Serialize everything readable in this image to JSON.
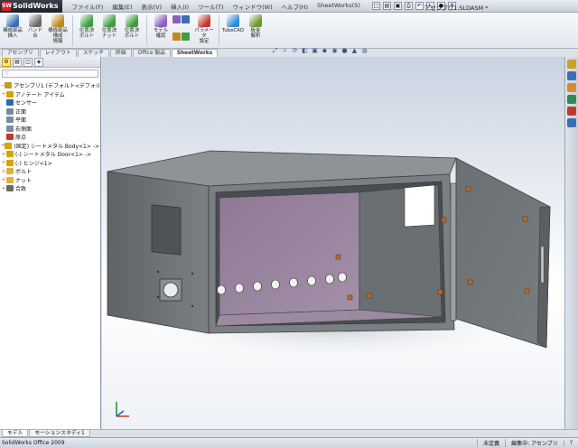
{
  "app": {
    "name": "SolidWorks",
    "document_title": "アセンブリ1.SLDASM *"
  },
  "menus": [
    "ファイル(F)",
    "編集(E)",
    "表示(V)",
    "挿入(I)",
    "ツール(T)",
    "ウィンドウ(W)",
    "ヘルプ(H)",
    "SheetWorks(S)"
  ],
  "ribbon": [
    {
      "label": "構成部品\n挿入",
      "icon": "insert-component-icon",
      "color": "#3a6fb8"
    },
    {
      "label": "ハンド\n合",
      "icon": "mate-icon",
      "color": "#6a6a6a"
    },
    {
      "label": "構成部品\n構成\n情報",
      "icon": "component-pattern-icon",
      "color": "#c08a1e"
    },
    {
      "label": "位置決\nボルト",
      "icon": "bolt-icon",
      "color": "#3f9d3f"
    },
    {
      "label": "位置決\nナット",
      "icon": "nut-icon",
      "color": "#3f9d3f"
    },
    {
      "label": "位置決\nボルト",
      "icon": "bolt2-icon",
      "color": "#3f9d3f"
    },
    {
      "label": "モデル\n確認",
      "icon": "model-check-icon",
      "color": "#8a5fc0"
    },
    {
      "label": "パラメータ\n設定",
      "icon": "parameter-icon",
      "color": "#c0392b"
    },
    {
      "label": "TubeCAD",
      "icon": "tubecad-icon",
      "color": "#2c8ad6"
    },
    {
      "label": "板金\n解析",
      "icon": "sheetmetal-icon",
      "color": "#6a9a2a"
    }
  ],
  "tabs": [
    "アセンブリ",
    "レイアウト",
    "スケッチ",
    "評価",
    "Office 製品",
    "SheetWorks"
  ],
  "active_tab": "SheetWorks",
  "view_toolbar": [
    "zoom-fit-icon",
    "zoom-area-icon",
    "rotate-icon",
    "section-icon",
    "view-orientation-icon",
    "display-style-icon",
    "hide-show-icon",
    "appearance-icon",
    "scene-icon",
    "photo-icon"
  ],
  "feature_tree": {
    "filter_placeholder": "",
    "root": "アセンブリ1 (デフォルト<デフォルト_表示",
    "nodes": [
      {
        "label": "アノテート アイテム",
        "icon": "annotation-icon",
        "color": "#d9a300",
        "expand": "+"
      },
      {
        "label": "センサー",
        "icon": "sensor-icon",
        "color": "#2b6cb0",
        "expand": ""
      },
      {
        "label": "正面",
        "icon": "plane-icon",
        "color": "#7a8aa0",
        "expand": ""
      },
      {
        "label": "平面",
        "icon": "plane-icon",
        "color": "#7a8aa0",
        "expand": ""
      },
      {
        "label": "右側面",
        "icon": "plane-icon",
        "color": "#7a8aa0",
        "expand": ""
      },
      {
        "label": "原点",
        "icon": "origin-icon",
        "color": "#c0392b",
        "expand": ""
      },
      {
        "label": "(固定) シートメタル Body<1> ->",
        "icon": "part-icon",
        "color": "#d9a300",
        "expand": "+"
      },
      {
        "label": "(-) シートメタル Door<1> ->",
        "icon": "part-icon",
        "color": "#d9a300",
        "expand": "+"
      },
      {
        "label": "(-) ヒンジ<1>",
        "icon": "part-icon",
        "color": "#d9a300",
        "expand": "+"
      },
      {
        "label": "ボルト",
        "icon": "folder-icon",
        "color": "#e0b23a",
        "expand": "+"
      },
      {
        "label": "ナット",
        "icon": "folder-icon",
        "color": "#e0b23a",
        "expand": "+"
      },
      {
        "label": "合致",
        "icon": "mates-icon",
        "color": "#6a6a6a",
        "expand": "+"
      }
    ]
  },
  "task_pane": [
    "resources-icon",
    "design-library-icon",
    "file-explorer-icon",
    "search-icon",
    "appearances-icon",
    "custom-properties-icon"
  ],
  "bottom_tabs": [
    "モデル",
    "モーションスタディ1"
  ],
  "status": {
    "version": "SolidWorks Office 2009",
    "state": "未定義",
    "mode": "編集中: アセンブリ"
  },
  "colors": {
    "enclosure": "#6f7376",
    "interior": "#8a6f8f",
    "door": "#6d7275",
    "accent": "#d52027"
  }
}
